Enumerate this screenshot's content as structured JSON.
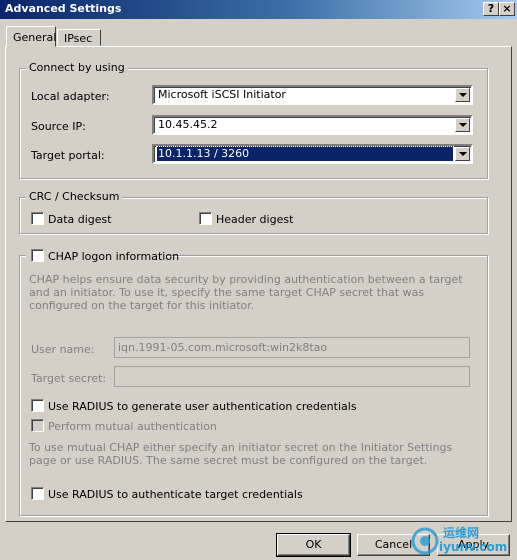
{
  "window": {
    "title": "Advanced Settings",
    "help_label": "?",
    "close_label": "×"
  },
  "tabs": [
    {
      "label": "General",
      "active": true
    },
    {
      "label": "IPsec",
      "active": false
    }
  ],
  "connect_group": {
    "title": "Connect by using",
    "local_adapter": {
      "label": "Local adapter:",
      "value": "Microsoft iSCSI Initiator"
    },
    "source_ip": {
      "label": "Source IP:",
      "value": "10.45.45.2"
    },
    "target_portal": {
      "label": "Target portal:",
      "value": "10.1.1.13 / 3260"
    }
  },
  "crc_group": {
    "title": "CRC / Checksum",
    "data_digest": {
      "label": "Data digest",
      "checked": false
    },
    "header_digest": {
      "label": "Header digest",
      "checked": false
    }
  },
  "chap_group": {
    "title": "CHAP logon information",
    "description": "CHAP helps ensure data security by providing authentication between a target and an initiator. To use it, specify the same target CHAP secret that was configured on the target for this initiator.",
    "user_name": {
      "label": "User name:",
      "value": "iqn.1991-05.com.microsoft:win2k8tao"
    },
    "target_secret": {
      "label": "Target secret:",
      "value": ""
    },
    "use_radius_user": {
      "label": "Use RADIUS to generate user authentication credentials",
      "checked": false
    },
    "mutual_auth": {
      "label": "Perform mutual authentication",
      "checked": false,
      "enabled": false
    },
    "mutual_description": "To use mutual CHAP either specify an initiator secret on the Initiator Settings page or use RADIUS.  The same secret must be configured on the target.",
    "use_radius_target": {
      "label": "Use RADIUS to authenticate target credentials",
      "checked": false
    }
  },
  "buttons": {
    "ok": "OK",
    "cancel": "Cancel",
    "apply": "Apply"
  },
  "watermark": {
    "cn_text": "运维网",
    "url_text": "iyunv.com"
  }
}
